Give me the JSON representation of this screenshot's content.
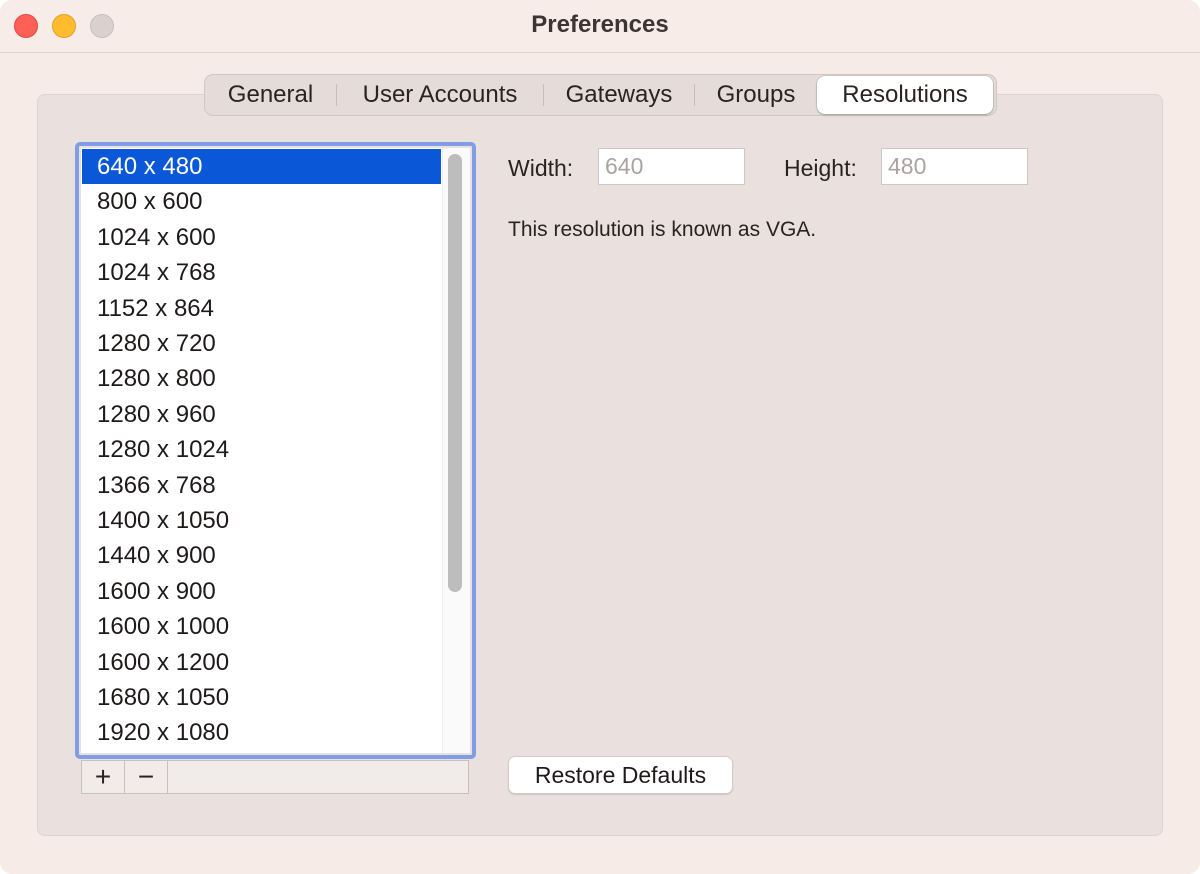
{
  "window": {
    "title": "Preferences"
  },
  "tabs": [
    {
      "label": "General",
      "active": false
    },
    {
      "label": "User Accounts",
      "active": false
    },
    {
      "label": "Gateways",
      "active": false
    },
    {
      "label": "Groups",
      "active": false
    },
    {
      "label": "Resolutions",
      "active": true
    }
  ],
  "resolutions": {
    "items": [
      "640 x 480",
      "800 x 600",
      "1024 x 600",
      "1024 x 768",
      "1152 x 864",
      "1280 x 720",
      "1280 x 800",
      "1280 x 960",
      "1280 x 1024",
      "1366 x 768",
      "1400 x 1050",
      "1440 x 900",
      "1600 x 900",
      "1600 x 1000",
      "1600 x 1200",
      "1680 x 1050",
      "1920 x 1080"
    ],
    "selected_index": 0,
    "add_label": "+",
    "remove_label": "−"
  },
  "detail": {
    "width_label": "Width:",
    "width_placeholder": "640",
    "height_label": "Height:",
    "height_placeholder": "480",
    "info": "This resolution is known as VGA."
  },
  "footer": {
    "restore_label": "Restore Defaults"
  },
  "colors": {
    "selection": "#0a57d8",
    "focus_ring": "#7f9ee6",
    "close": "#fe5f57",
    "minimize": "#febc2e",
    "zoom_inactive": "#d9d1ce"
  }
}
